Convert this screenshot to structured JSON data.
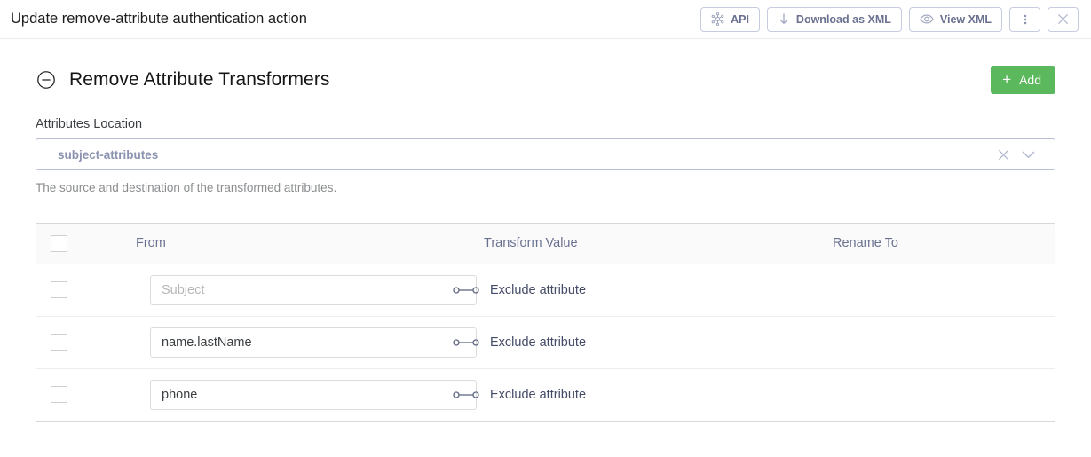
{
  "topbar": {
    "title": "Update remove-attribute authentication action",
    "buttons": [
      {
        "label": "API",
        "icon": "api-nodes-icon"
      },
      {
        "label": "Download as XML",
        "icon": "download-arrow-icon"
      },
      {
        "label": "View XML",
        "icon": "eye-icon"
      }
    ],
    "kebab_label": "",
    "close_label": ""
  },
  "section": {
    "title": "Remove Attribute Transformers",
    "collapse_icon": "minus-circle-icon",
    "add_label": "Add",
    "add_plus": "+",
    "add_color": "#5cb85c"
  },
  "attributes_location": {
    "label": "Attributes Location",
    "value": "subject-attributes",
    "helper": "The source and destination of the transformed attributes.",
    "clear_icon": "close-icon",
    "chevron_icon": "chevron-down-icon"
  },
  "table": {
    "headers": {
      "check": "",
      "from": "From",
      "transform_value": "Transform Value",
      "rename_to": "Rename To"
    },
    "rows": [
      {
        "from_value": "",
        "from_placeholder": "Subject",
        "transform_value": "Exclude attribute",
        "rename_to": ""
      },
      {
        "from_value": "name.lastName",
        "from_placeholder": "",
        "transform_value": "Exclude attribute",
        "rename_to": ""
      },
      {
        "from_value": "phone",
        "from_placeholder": "",
        "transform_value": "Exclude attribute",
        "rename_to": ""
      }
    ]
  }
}
